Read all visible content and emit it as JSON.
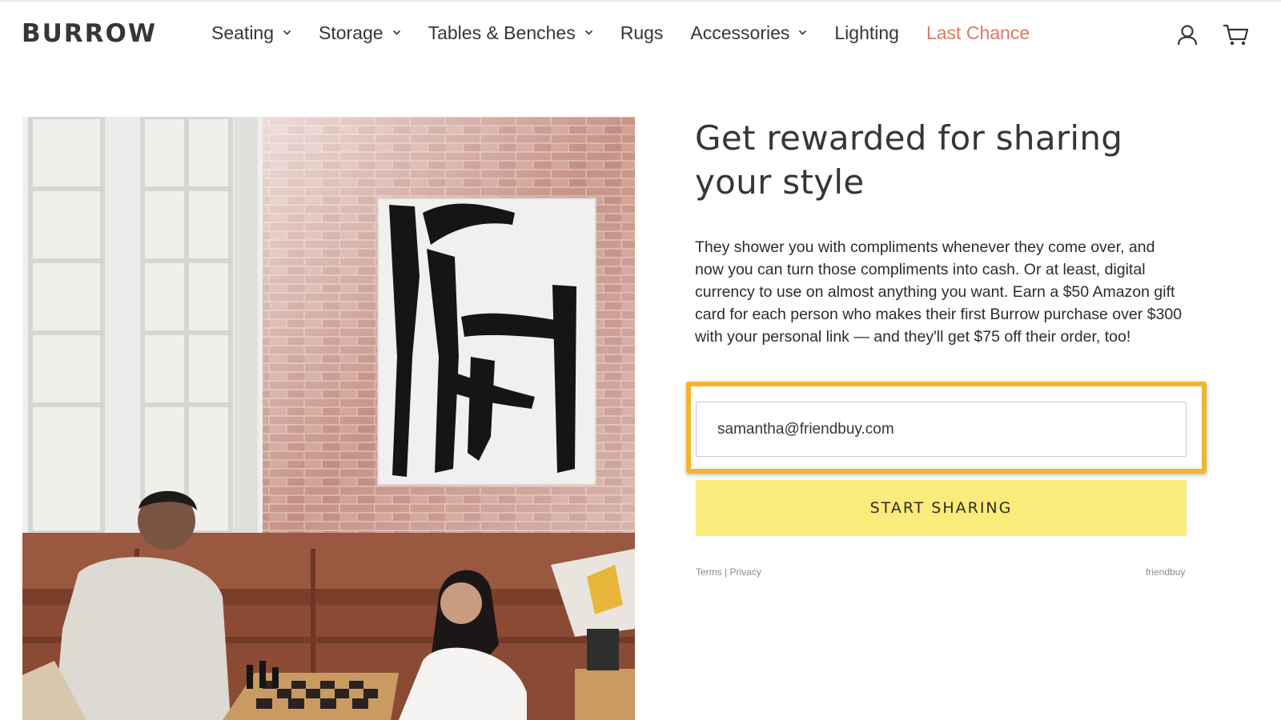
{
  "header": {
    "logo": "BURROW",
    "nav": [
      {
        "label": "Seating",
        "has_dropdown": true
      },
      {
        "label": "Storage",
        "has_dropdown": true
      },
      {
        "label": "Tables & Benches",
        "has_dropdown": true
      },
      {
        "label": "Rugs",
        "has_dropdown": false
      },
      {
        "label": "Accessories",
        "has_dropdown": true
      },
      {
        "label": "Lighting",
        "has_dropdown": false
      },
      {
        "label": "Last Chance",
        "has_dropdown": false
      }
    ],
    "icons": [
      "account-icon",
      "cart-icon"
    ]
  },
  "main": {
    "headline": "Get rewarded for sharing your style",
    "body": "They shower you with compliments whenever they come over, and now you can turn those compliments into cash. Or at least, digital currency to use on almost anything you want. Earn a $50 Amazon gift card for each person who makes their first Burrow purchase over $300 with your personal link — and they'll get $75 off their order, too!",
    "email_value": "samantha@friendbuy.com",
    "cta_label": "START SHARING",
    "terms_label": "Terms",
    "separator": "|",
    "privacy_label": "Privacy",
    "powered_by": "friendbuy"
  },
  "colors": {
    "accent_sale": "#e27864",
    "cta_background": "#fbeb7a",
    "highlight_border": "#f2b62c",
    "text": "#3a3532"
  }
}
